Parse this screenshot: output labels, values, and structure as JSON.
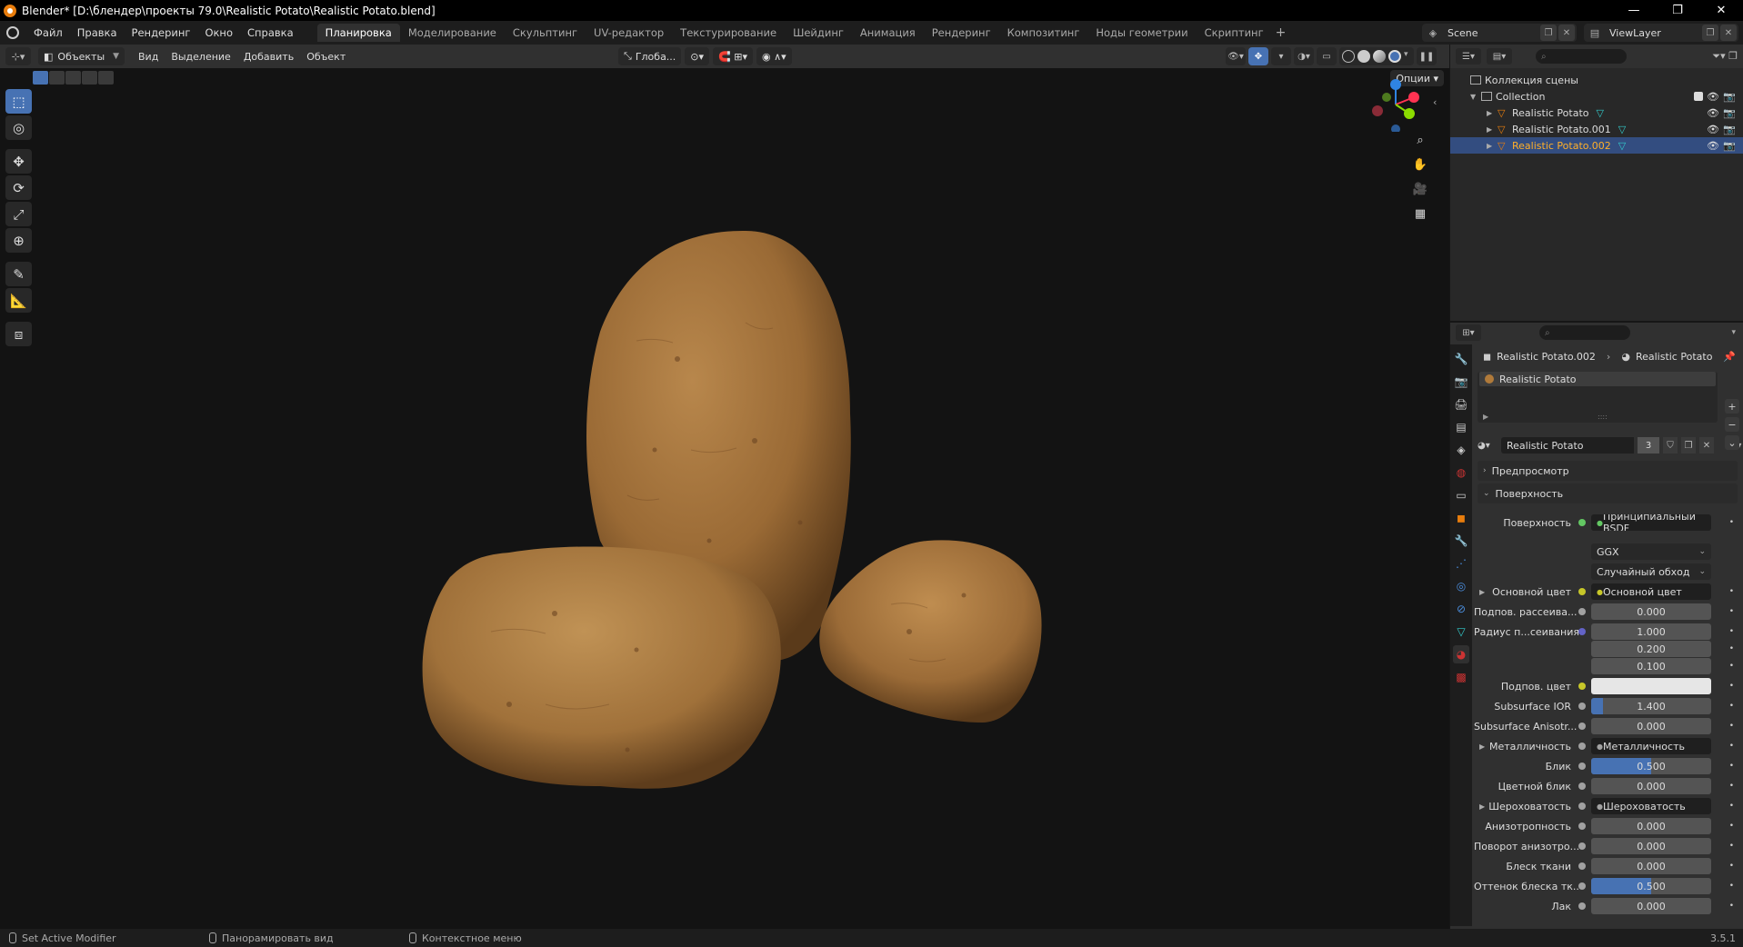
{
  "window": {
    "title": "Blender* [D:\\блендер\\проекты 79.0\\Realistic Potato\\Realistic Potato.blend]",
    "controls": [
      "—",
      "❐",
      "✕"
    ]
  },
  "menu": [
    "Файл",
    "Правка",
    "Рендеринг",
    "Окно",
    "Справка"
  ],
  "workspaces": [
    "Планировка",
    "Моделирование",
    "Скульптинг",
    "UV-редактор",
    "Текстурирование",
    "Шейдинг",
    "Анимация",
    "Рендеринг",
    "Композитинг",
    "Ноды геометрии",
    "Скриптинг"
  ],
  "active_workspace_index": 0,
  "scene": {
    "name": "Scene"
  },
  "view_layer": {
    "name": "ViewLayer"
  },
  "viewport": {
    "mode": "Объекты",
    "menu": [
      "Вид",
      "Выделение",
      "Добавить",
      "Объект"
    ],
    "transform_orientation": "Глоба...",
    "options_label": "Опции"
  },
  "outliner": {
    "scene_collection": "Коллекция сцены",
    "collection": "Collection",
    "objects": [
      {
        "name": "Realistic Potato",
        "selected": false
      },
      {
        "name": "Realistic Potato.001",
        "selected": false
      },
      {
        "name": "Realistic Potato.002",
        "selected": true
      }
    ]
  },
  "properties": {
    "breadcrumb": {
      "object": "Realistic Potato.002",
      "material": "Realistic Potato"
    },
    "slot_material": "Realistic Potato",
    "material_name": "Realistic Potato",
    "users": "3",
    "panels": {
      "preview": "Предпросмотр",
      "surface": "Поверхность"
    },
    "rows": [
      {
        "label": "Поверхность",
        "type": "link",
        "value": "Принципиальный BSDF",
        "dot": "#63c763"
      },
      {
        "label": "",
        "type": "select",
        "value": "GGX"
      },
      {
        "label": "",
        "type": "select",
        "value": "Случайный обход"
      },
      {
        "label": "Основной цвет",
        "type": "link",
        "value": "Основной цвет",
        "dot": "#c7c729",
        "expand": true
      },
      {
        "label": "Подпов. рассеива...",
        "type": "num",
        "value": "0.000",
        "dot": "#a1a1a1",
        "fill": 0
      },
      {
        "label": "Радиус п...сеивания",
        "type": "num",
        "value": "1.000",
        "dot": "#6363c7",
        "fill": 0
      },
      {
        "label": "",
        "type": "num",
        "value": "0.200",
        "fill": 0
      },
      {
        "label": "",
        "type": "num",
        "value": "0.100",
        "fill": 0
      },
      {
        "label": "Подпов. цвет",
        "type": "color",
        "value": "",
        "dot": "#c7c729"
      },
      {
        "label": "Subsurface IOR",
        "type": "num",
        "value": "1.400",
        "dot": "#a1a1a1",
        "fill": 0.1
      },
      {
        "label": "Subsurface Anisotr...",
        "type": "num",
        "value": "0.000",
        "dot": "#a1a1a1",
        "fill": 0
      },
      {
        "label": "Металличность",
        "type": "link",
        "value": "Металличность",
        "dot": "#a1a1a1",
        "expand": true
      },
      {
        "label": "Блик",
        "type": "num",
        "value": "0.500",
        "dot": "#a1a1a1",
        "fill": 0.5
      },
      {
        "label": "Цветной блик",
        "type": "num",
        "value": "0.000",
        "dot": "#a1a1a1",
        "fill": 0
      },
      {
        "label": "Шероховатость",
        "type": "link",
        "value": "Шероховатость",
        "dot": "#a1a1a1",
        "expand": true
      },
      {
        "label": "Анизотропность",
        "type": "num",
        "value": "0.000",
        "dot": "#a1a1a1",
        "fill": 0
      },
      {
        "label": "Поворот анизотро...",
        "type": "num",
        "value": "0.000",
        "dot": "#a1a1a1",
        "fill": 0
      },
      {
        "label": "Блеск ткани",
        "type": "num",
        "value": "0.000",
        "dot": "#a1a1a1",
        "fill": 0
      },
      {
        "label": "Оттенок блеска тк...",
        "type": "num",
        "value": "0.500",
        "dot": "#a1a1a1",
        "fill": 0.5
      },
      {
        "label": "Лак",
        "type": "num",
        "value": "0.000",
        "dot": "#a1a1a1",
        "fill": 0
      }
    ]
  },
  "statusbar": {
    "items": [
      "Set Active Modifier",
      "Панорамировать вид",
      "Контекстное меню"
    ],
    "version": "3.5.1"
  },
  "colors": {
    "accent": "#4772b3",
    "selection": "#334d80",
    "object": "#e87d0d"
  }
}
